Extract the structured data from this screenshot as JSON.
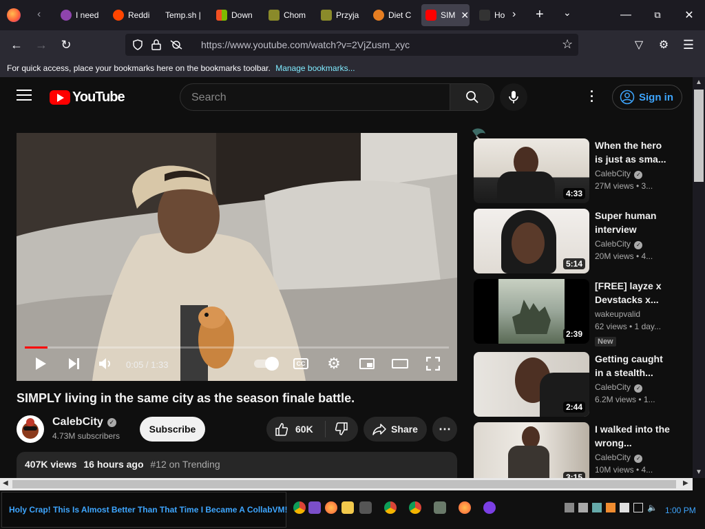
{
  "browser": {
    "tabs": [
      {
        "label": "I need",
        "color": "#8e44ad"
      },
      {
        "label": "Reddi",
        "color": "#ff4500"
      },
      {
        "label": "Temp.sh |",
        "color": "#2b2a33"
      },
      {
        "label": "Down",
        "color": "#0078d7"
      },
      {
        "label": "Chom",
        "color": "#8a8a2a"
      },
      {
        "label": "Przyja",
        "color": "#8a8a2a"
      },
      {
        "label": "Diet C",
        "color": "#e67e22"
      },
      {
        "label": "SIM",
        "color": "#ff0000"
      },
      {
        "label": "Ho",
        "color": "#333333"
      }
    ],
    "url": "https://www.youtube.com/watch?v=2VjZusm_xyc",
    "bookmarks_message": "For quick access, place your bookmarks here on the bookmarks toolbar.",
    "bookmarks_link": "Manage bookmarks..."
  },
  "youtube": {
    "logo_text": "YouTube",
    "search_placeholder": "Search",
    "sign_in": "Sign in",
    "player": {
      "time": "0:05 / 1:33",
      "progress_fraction": 0.054
    },
    "video": {
      "title": "SIMPLY living in the same city as the season finale battle.",
      "channel": "CalebCity",
      "subscribers": "4.73M subscribers",
      "subscribe_label": "Subscribe",
      "likes": "60K",
      "share_label": "Share",
      "views": "407K views",
      "age": "16 hours ago",
      "trending": "#12 on Trending"
    },
    "recommendations": [
      {
        "title": "When the hero is just as sma...",
        "channel": "CalebCity",
        "verified": true,
        "meta": "27M views • 3...",
        "duration": "4:33",
        "badge": ""
      },
      {
        "title": "Super human interview",
        "channel": "CalebCity",
        "verified": true,
        "meta": "20M views • 4...",
        "duration": "5:14",
        "badge": ""
      },
      {
        "title": "[FREE] layze x Devstacks x...",
        "channel": "wakeupvalid",
        "verified": false,
        "meta": "62 views • 1 day...",
        "duration": "2:39",
        "badge": "New"
      },
      {
        "title": "Getting caught in a stealth...",
        "channel": "CalebCity",
        "verified": true,
        "meta": "6.2M views • 1...",
        "duration": "2:44",
        "badge": ""
      },
      {
        "title": "I walked into the wrong...",
        "channel": "CalebCity",
        "verified": true,
        "meta": "10M views • 4...",
        "duration": "3:15",
        "badge": ""
      }
    ]
  },
  "taskbar": {
    "active_window": "Holy Crap! This Is Almost Better Than That Time I Became A CollabVM!",
    "clock": "1:00 PM"
  }
}
